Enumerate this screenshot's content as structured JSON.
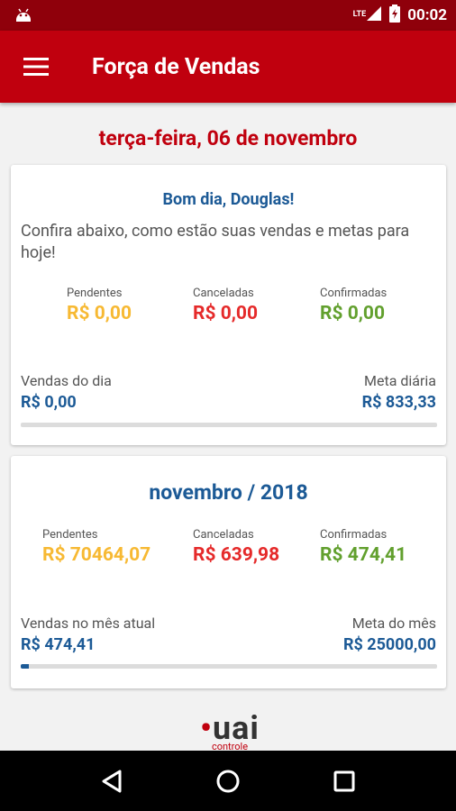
{
  "statusbar": {
    "network": "LTE",
    "time": "00:02"
  },
  "appbar": {
    "title": "Força de Vendas"
  },
  "date_title": "terça-feira, 06 de novembro",
  "daily": {
    "greeting": "Bom dia, Douglas!",
    "intro": "Confira abaixo, como estão suas vendas e metas para hoje!",
    "stats": [
      {
        "label": "Pendentes",
        "value": "R$ 0,00"
      },
      {
        "label": "Canceladas",
        "value": "R$ 0,00"
      },
      {
        "label": "Confirmadas",
        "value": "R$ 0,00"
      }
    ],
    "sales_label": "Vendas do dia",
    "sales_value": "R$ 0,00",
    "goal_label": "Meta diária",
    "goal_value": "R$ 833,33",
    "progress_fraction": 0.0
  },
  "monthly": {
    "title": "novembro / 2018",
    "stats": [
      {
        "label": "Pendentes",
        "value": "R$ 70464,07"
      },
      {
        "label": "Canceladas",
        "value": "R$ 639,98"
      },
      {
        "label": "Confirmadas",
        "value": "R$ 474,41"
      }
    ],
    "sales_label": "Vendas no mês atual",
    "sales_value": "R$ 474,41",
    "goal_label": "Meta do mês",
    "goal_value": "R$ 25000,00",
    "progress_fraction": 0.019
  },
  "logo": {
    "text": "uai",
    "subtext": "controle"
  },
  "colors": {
    "primary": "#c0000e",
    "statusbar": "#8f000b",
    "blue": "#1c5a96",
    "pending": "#f7b933",
    "cancelled": "#e52a2a",
    "confirmed": "#62a02e"
  }
}
